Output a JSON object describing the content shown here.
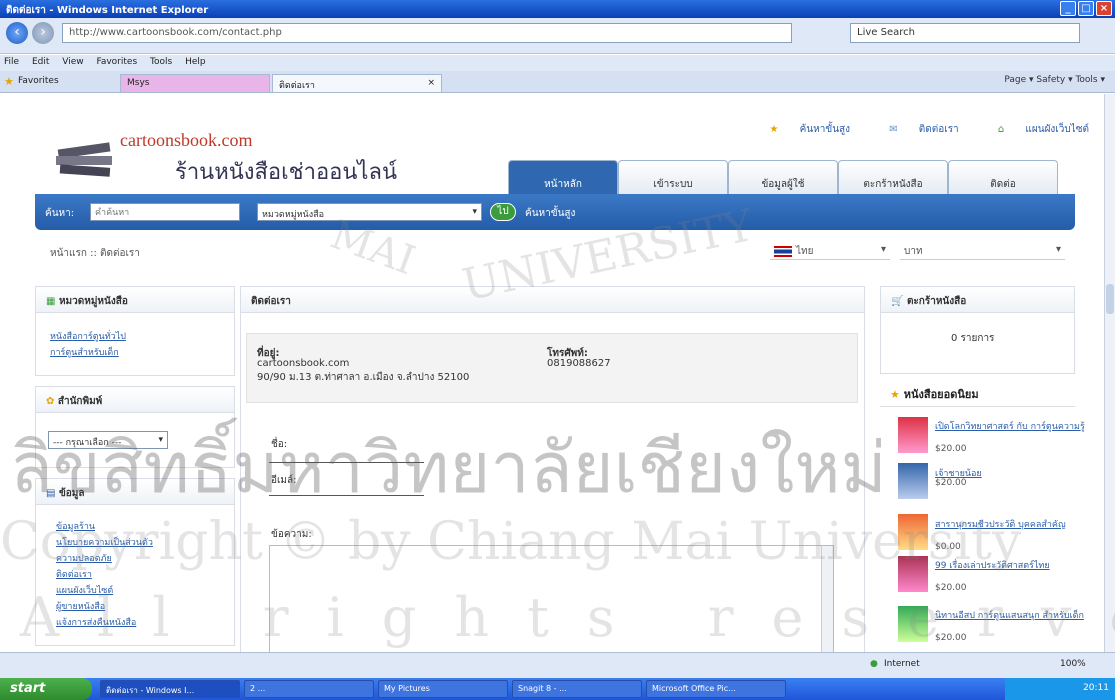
{
  "window": {
    "title": "ติดต่อเรา - Windows Internet Explorer"
  },
  "browser": {
    "url": "http://www.cartoonsbook.com/contact.php",
    "search_text": "Live Search",
    "menu": [
      "File",
      "Edit",
      "View",
      "Favorites",
      "Tools",
      "Help"
    ],
    "favorites_label": "Favorites",
    "tabs": [
      "Msys",
      "ติดต่อเรา"
    ],
    "commands": "Page ▾  Safety ▾  Tools ▾"
  },
  "site": {
    "name": "cartoonsbook.com",
    "subtitle": "ร้านหนังสือเช่าออนไลน์",
    "top_links": [
      "ค้นหาขั้นสูง",
      "ติดต่อเรา",
      "แผนผังเว็บไซต์"
    ],
    "nav": [
      "หน้าหลัก",
      "เข้าระบบ",
      "ข้อมูลผู้ใช้",
      "ตะกร้าหนังสือ",
      "ติดต่อ"
    ]
  },
  "search": {
    "label": "ค้นหา:",
    "placeholder": "คำค้นหา",
    "category": "หมวดหมู่หนังสือ",
    "go": "ไป",
    "advanced": "ค้นหาขั้นสูง"
  },
  "breadcrumb": "หน้าแรก :: ติดต่อเรา",
  "lang": "ไทย",
  "currency": "บาท",
  "sidebar": {
    "categories_title": "หมวดหมู่หนังสือ",
    "categories": [
      "หนังสือการ์ตูนทั่วไป",
      "การ์ตูนสำหรับเด็ก"
    ],
    "publisher_title": "สำนักพิมพ์",
    "publisher_select": "--- กรุณาเลือก ---",
    "info_title": "ข้อมูล",
    "info_links": [
      "ข้อมูลร้าน",
      "นโยบายความเป็นส่วนตัว",
      "ความปลอดภัย",
      "ติดต่อเรา",
      "แผนผังเว็บไซต์",
      "ผู้ขายหนังสือ",
      "แจ้งการส่งคืนหนังสือ"
    ]
  },
  "main": {
    "title": "ติดต่อเรา",
    "address_label": "ที่อยู่:",
    "address_lines": [
      "cartoonsbook.com",
      "90/90 ม.13 ต.ท่าศาลา อ.เมือง จ.ลำปาง 52100"
    ],
    "phone_label": "โทรศัพท์:",
    "phone": "0819088627",
    "name_label": "ชื่อ:",
    "email_label": "อีเมล์:",
    "message_label": "ข้อความ:"
  },
  "cart": {
    "title": "ตะกร้าหนังสือ",
    "count": "0 รายการ"
  },
  "popular": {
    "title": "หนังสือยอดนิยม",
    "items": [
      {
        "title": "เปิดโลกวิทยาศาสตร์ กับ การ์ตูนความรู้",
        "price": "$20.00"
      },
      {
        "title": "เจ้าชายน้อย",
        "price": "$20.00"
      },
      {
        "title": "สารานุกรมชีวประวัติ บุคคลสำคัญ",
        "price": "$0.00"
      },
      {
        "title": "99 เรื่องเล่าประวัติศาสตร์ไทย",
        "price": "$20.00"
      },
      {
        "title": "นิทานอีสป การ์ตูนแสนสนุก สำหรับเด็ก",
        "price": "$20.00"
      }
    ]
  },
  "status": {
    "zone": "Internet",
    "zoom": "100%"
  },
  "taskbar": {
    "start": "start",
    "items": [
      "ติดต่อเรา - Windows I...",
      "2 ...",
      "My Pictures",
      "Snagit 8 - ...",
      "Microsoft Office Pic..."
    ],
    "clock": "20:11"
  },
  "watermark": {
    "university": "UNIVERSITY",
    "mai": "MAI",
    "thai": "ลิขสิทธิ์มหาวิทยาลัยเชียงใหม่",
    "copyright": "Copyright © by Chiang Mai University",
    "rights": "All rights reserved"
  }
}
